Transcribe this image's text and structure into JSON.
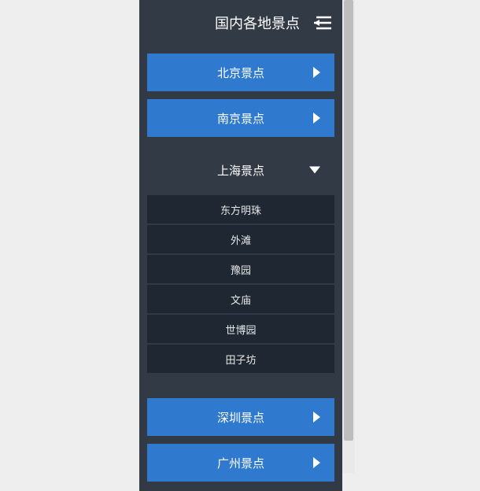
{
  "header": {
    "title": "国内各地景点"
  },
  "items": [
    {
      "label": "北京景点",
      "expanded": false
    },
    {
      "label": "南京景点",
      "expanded": false
    },
    {
      "label": "上海景点",
      "expanded": true,
      "children": [
        "东方明珠",
        "外滩",
        "豫园",
        "文庙",
        "世博园",
        "田子坊"
      ]
    },
    {
      "label": "深圳景点",
      "expanded": false
    },
    {
      "label": "广州景点",
      "expanded": false
    }
  ]
}
